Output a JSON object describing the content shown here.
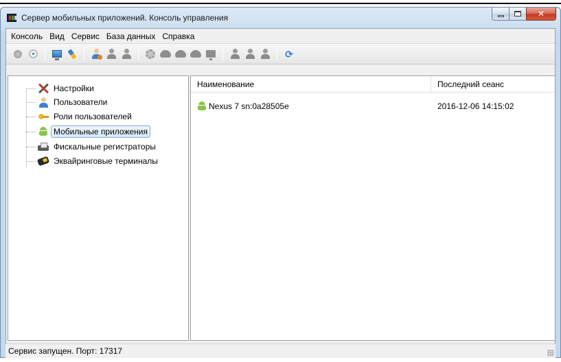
{
  "window": {
    "title": "Сервер мобильных приложений. Консоль управления"
  },
  "menu": [
    "Консоль",
    "Вид",
    "Сервис",
    "База данных",
    "Справка"
  ],
  "tree": {
    "items": [
      {
        "label": "Настройки",
        "icon": "tools-icon"
      },
      {
        "label": "Пользователи",
        "icon": "user-icon"
      },
      {
        "label": "Роли пользователей",
        "icon": "key-icon"
      },
      {
        "label": "Мобильные приложения",
        "icon": "android-icon",
        "selected": true
      },
      {
        "label": "Фискальные регистраторы",
        "icon": "printer-icon"
      },
      {
        "label": "Эквайринговые терминалы",
        "icon": "card-terminal-icon"
      }
    ]
  },
  "list": {
    "columns": [
      "Наименование",
      "Последний сеанс"
    ],
    "rows": [
      {
        "name": "Nexus 7 sn:0a28505e",
        "last_session": "2016-12-06 14:15:02",
        "icon": "android-icon"
      }
    ]
  },
  "status": {
    "text": "Сервис запущен. Порт: 17317"
  },
  "colors": {
    "selection_border": "#84acdd",
    "android_green": "#8bc34a",
    "close_button": "#c23a22"
  }
}
